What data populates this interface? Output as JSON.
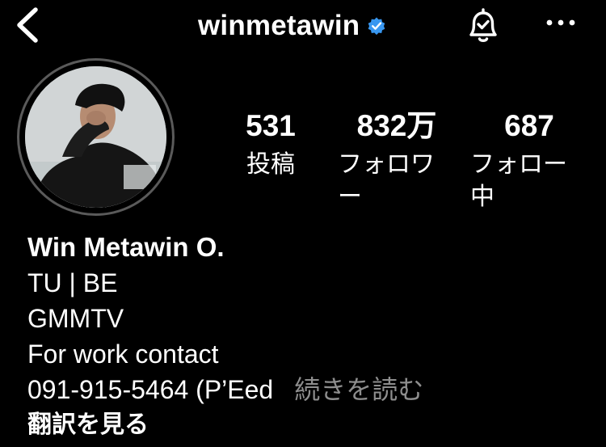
{
  "header": {
    "username": "winmetawin",
    "back_icon": "chevron-left-icon",
    "verified_icon": "verified-badge-icon",
    "notify_icon": "bell-check-icon",
    "more_icon": "more-horizontal-icon",
    "verified_color": "#3897f0"
  },
  "stats": {
    "posts": {
      "value": "531",
      "label": "投稿"
    },
    "followers": {
      "value": "832万",
      "label": "フォロワー"
    },
    "following": {
      "value": "687",
      "label": "フォロー中"
    }
  },
  "bio": {
    "name": "Win Metawin O.",
    "line1": "TU | BE",
    "line2": "GMMTV",
    "line3": "For work contact",
    "line4": "091-915-5464 (P’Eed",
    "more": "続きを読む",
    "translate": "翻訳を見る"
  }
}
